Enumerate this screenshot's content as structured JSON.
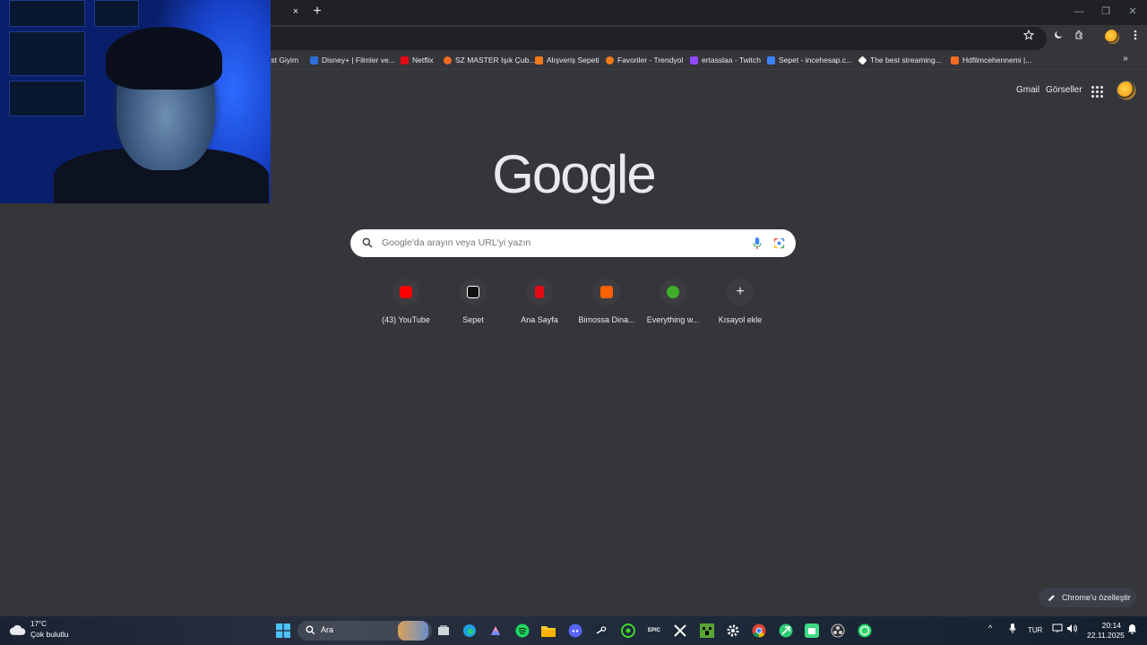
{
  "browser": {
    "tab_close": "×",
    "new_tab": "+",
    "window_controls": [
      "—",
      "❐",
      "✕"
    ]
  },
  "bookmarks": [
    {
      "label": "İst Giyim",
      "icon_color": "#35363a"
    },
    {
      "label": "Disney+ | Filmler ve...",
      "icon_color": "#2f6fdc"
    },
    {
      "label": "Netflix",
      "icon_color": "#e50914"
    },
    {
      "label": "SZ MASTER Işık Çub...",
      "icon_color": "#f26b21"
    },
    {
      "label": "Alışveriş Sepeti",
      "icon_color": "#f27a1a"
    },
    {
      "label": "Favoriler - Trendyol",
      "icon_color": "#f27a1a"
    },
    {
      "label": "ertasslaa - Twitch",
      "icon_color": "#9146ff"
    },
    {
      "label": "Sepet - incehesap.c...",
      "icon_color": "#3b82f6"
    },
    {
      "label": "The best streaming...",
      "icon_color": "#ffffff"
    },
    {
      "label": "Hdfilmcehennemi |...",
      "icon_color": "#f26b21"
    }
  ],
  "top_links": {
    "gmail": "Gmail",
    "images": "Görseller"
  },
  "logo": "Google",
  "search": {
    "placeholder": "Google'da arayın veya URL'yi yazın"
  },
  "shortcuts": [
    {
      "label": "(43) YouTube",
      "icon_color": "#ff0000"
    },
    {
      "label": "Sepet",
      "icon_color": "#111111"
    },
    {
      "label": "Ana Sayfa",
      "icon_color": "#e50914"
    },
    {
      "label": "Bimossa Dina...",
      "icon_color": "#ff6000"
    },
    {
      "label": "Everything w...",
      "icon_color": "#3fae2a"
    },
    {
      "label": "Kısayol ekle",
      "icon_color": "#3c3c40"
    }
  ],
  "customize": {
    "label": "Chrome'u özelleştir"
  },
  "taskbar": {
    "weather_temp": "17°C",
    "weather_desc": "Çok bulutlu",
    "search_text": "Ara",
    "language": "TUR",
    "time": "20:14",
    "date": "22.11.2025"
  }
}
